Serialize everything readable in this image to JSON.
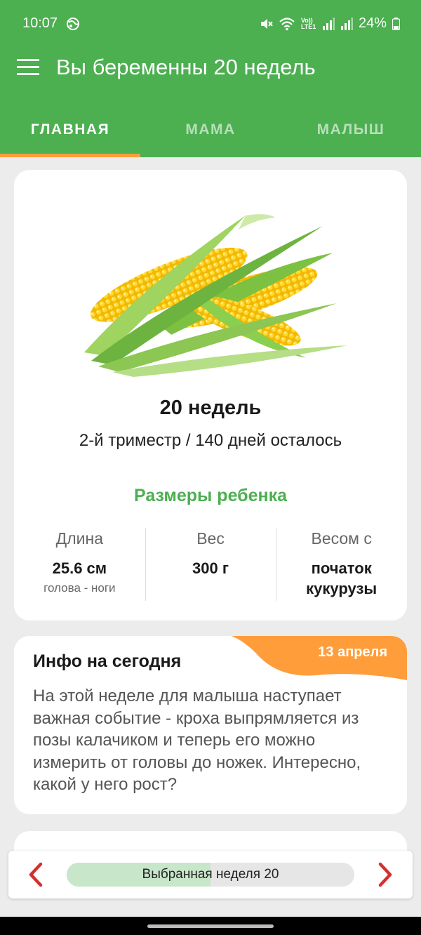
{
  "status_bar": {
    "time": "10:07",
    "network_label": "Vo)) LTE1",
    "battery": "24%"
  },
  "app_bar": {
    "title": "Вы беременны 20 недель",
    "menu_icon": "hamburger-menu-icon"
  },
  "tabs": [
    {
      "label": "ГЛАВНАЯ",
      "active": true
    },
    {
      "label": "МАМА",
      "active": false
    },
    {
      "label": "МАЛЫШ",
      "active": false
    }
  ],
  "summary_card": {
    "image": "corn-cobs-illustration",
    "week_title": "20 недель",
    "trimester_text": "2-й триместр / 140 дней осталось",
    "sizes_title": "Размеры ребенка",
    "stats": [
      {
        "label": "Длина",
        "value": "25.6 см",
        "sub": "голова - ноги"
      },
      {
        "label": "Вес",
        "value": "300 г",
        "sub": ""
      },
      {
        "label": "Весом с",
        "value": "початок кукурузы",
        "sub": ""
      }
    ]
  },
  "info_card": {
    "date": "13 апреля",
    "title": "Инфо на сегодня",
    "body": "На этой неделе для малыша наступает важная событие - кроха выпрямляется из позы калачиком и теперь его можно измерить от головы до ножек. Интересно, какой у него рост?"
  },
  "week_selector": {
    "label": "Выбранная неделя 20",
    "progress_fraction": 0.5
  },
  "colors": {
    "primary": "#4caf50",
    "accent": "#ff9d3b",
    "arrow": "#d32f2f",
    "progress_fill": "#c8e6c9"
  }
}
